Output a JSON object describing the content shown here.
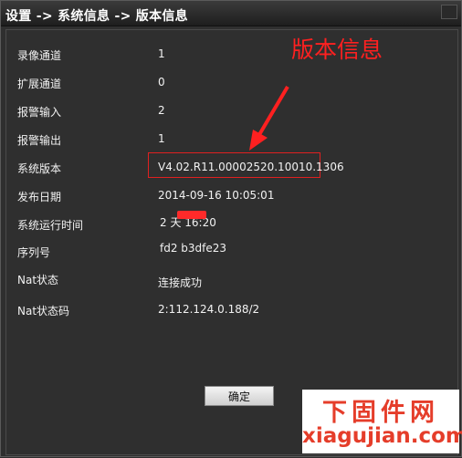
{
  "window": {
    "title": "设置 -> 系统信息 -> 版本信息"
  },
  "rows": [
    {
      "label": "录像通道",
      "value": "1"
    },
    {
      "label": "扩展通道",
      "value": "0"
    },
    {
      "label": "报警输入",
      "value": "2"
    },
    {
      "label": "报警输出",
      "value": "1"
    },
    {
      "label": "系统版本",
      "value": "V4.02.R11.00002520.10010.1306"
    },
    {
      "label": "发布日期",
      "value": "2014-09-16 10:05:01"
    },
    {
      "label": "系统运行时间",
      "value": "2 天 16:20"
    },
    {
      "label": "序列号",
      "value": "fd2          b3dfe23"
    },
    {
      "label": "Nat状态",
      "value": "连接成功"
    },
    {
      "label": "Nat状态码",
      "value": "2:112.124.0.188/2"
    }
  ],
  "annotation": {
    "text": "版本信息",
    "color": "#ff2020"
  },
  "buttons": {
    "ok_label": "确定"
  },
  "watermark": {
    "title": "下固件网",
    "url": "xiagujian.com",
    "color": "#e53d2a"
  }
}
